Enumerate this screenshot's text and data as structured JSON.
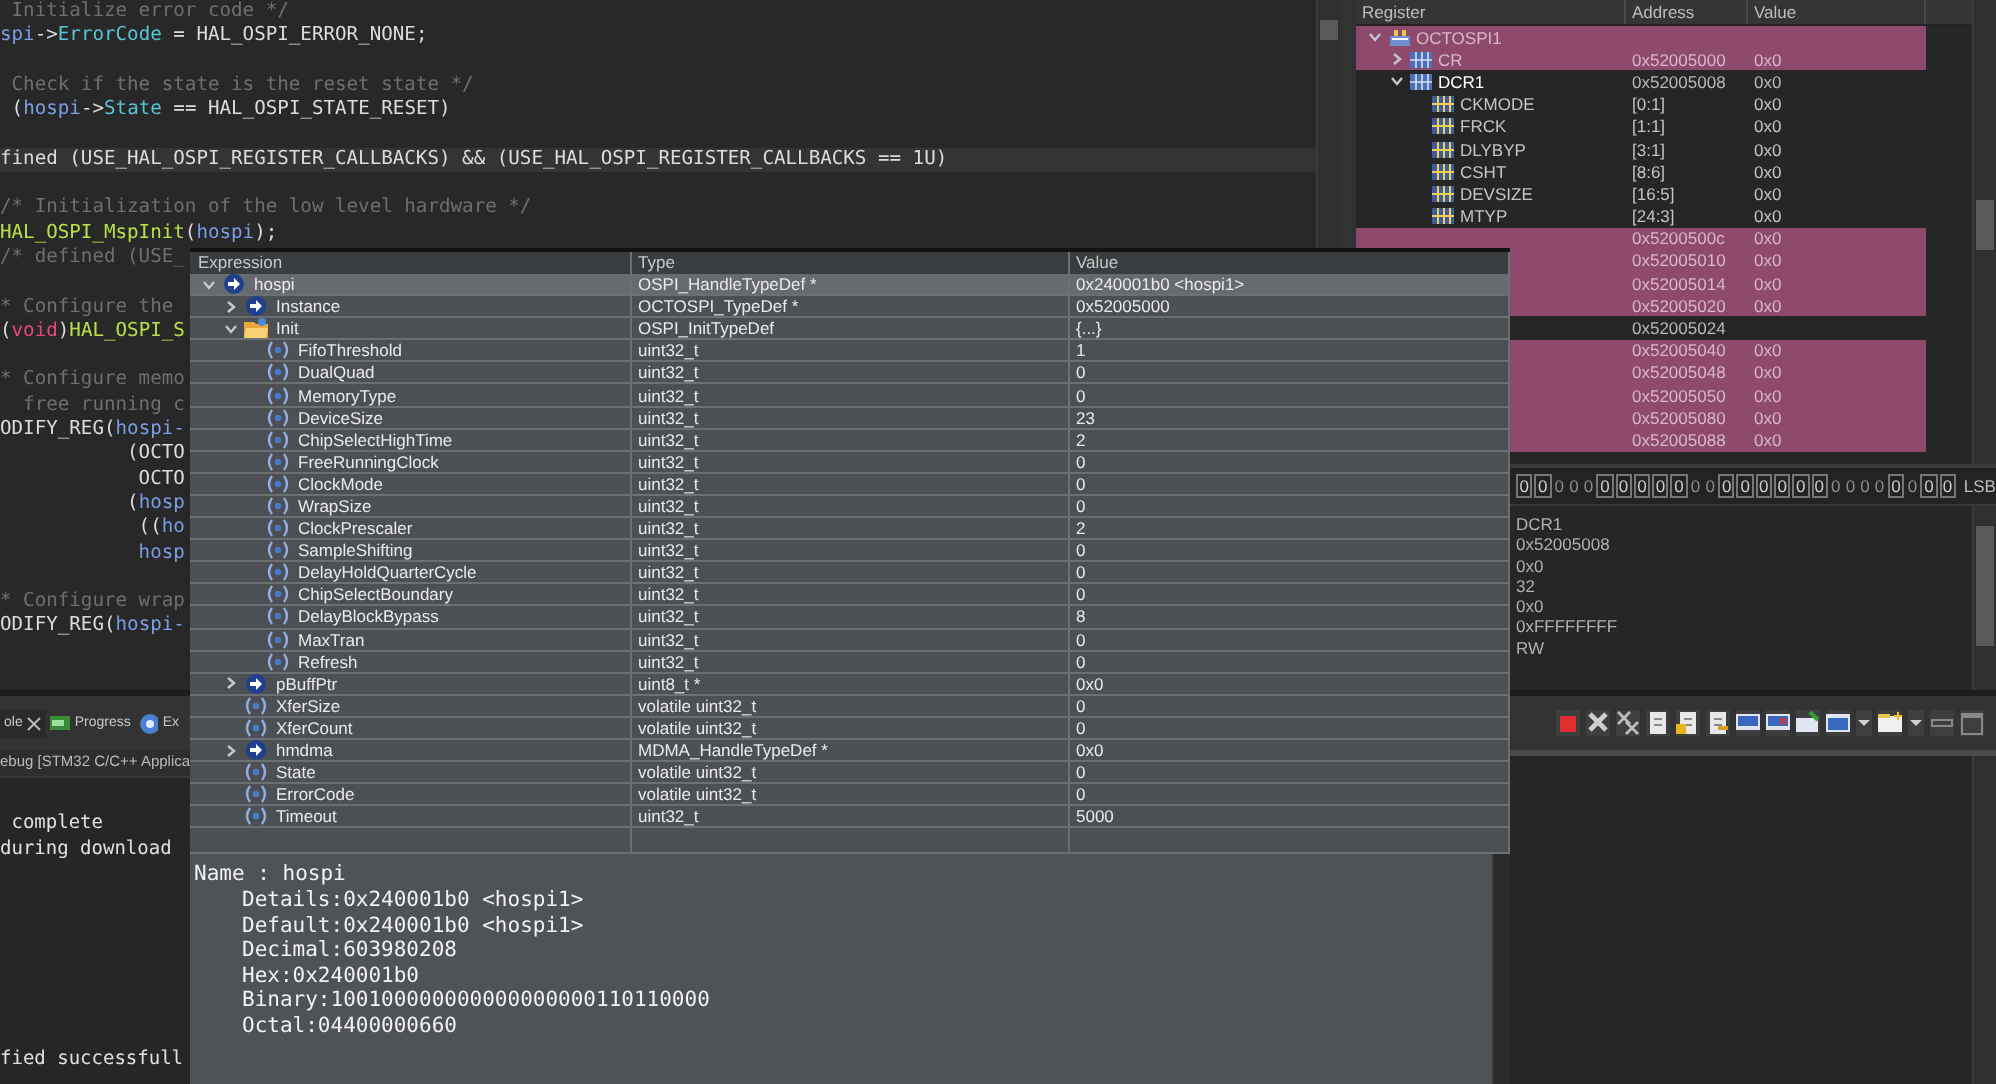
{
  "editor": {
    "lines": [
      {
        "kind": "code",
        "current": false,
        "segments": [
          {
            "text": " Initialize error code */",
            "kind": "comment"
          }
        ]
      },
      {
        "kind": "code",
        "current": false,
        "segments": [
          {
            "text": "spi",
            "kind": "var"
          },
          {
            "text": "->",
            "kind": "plain"
          },
          {
            "text": "ErrorCode",
            "kind": "field"
          },
          {
            "text": " = HAL_OSPI_ERROR_NONE;",
            "kind": "plain"
          }
        ]
      },
      {
        "kind": "blank"
      },
      {
        "kind": "code",
        "current": false,
        "segments": [
          {
            "text": " Check if the state is the reset state */",
            "kind": "comment"
          }
        ]
      },
      {
        "kind": "code",
        "current": false,
        "segments": [
          {
            "text": " (",
            "kind": "plain"
          },
          {
            "text": "hospi",
            "kind": "var"
          },
          {
            "text": "->",
            "kind": "plain"
          },
          {
            "text": "State",
            "kind": "field"
          },
          {
            "text": " == HAL_OSPI_STATE_RESET)",
            "kind": "plain"
          }
        ]
      },
      {
        "kind": "blank"
      },
      {
        "kind": "code",
        "current": true,
        "segments": [
          {
            "text": "fined (USE_HAL_OSPI_REGISTER_CALLBACKS) && (USE_HAL_OSPI_REGISTER_CALLBACKS == 1U)",
            "kind": "plain"
          }
        ]
      },
      {
        "kind": "blank"
      },
      {
        "kind": "code",
        "current": false,
        "segments": [
          {
            "text": "/* Initialization of the low level hardware */",
            "kind": "comment"
          }
        ]
      },
      {
        "kind": "code",
        "current": false,
        "segments": [
          {
            "text": "HAL_OSPI_MspInit",
            "kind": "func"
          },
          {
            "text": "(",
            "kind": "plain"
          },
          {
            "text": "hospi",
            "kind": "var"
          },
          {
            "text": ");",
            "kind": "plain"
          }
        ]
      },
      {
        "kind": "code",
        "current": false,
        "segments": [
          {
            "text": "/* defined (USE_",
            "kind": "comment"
          }
        ]
      },
      {
        "kind": "blank"
      },
      {
        "kind": "code",
        "current": false,
        "segments": [
          {
            "text": "* Configure the",
            "kind": "comment"
          }
        ]
      },
      {
        "kind": "code",
        "current": false,
        "segments": [
          {
            "text": "(",
            "kind": "plain"
          },
          {
            "text": "void",
            "kind": "keyword"
          },
          {
            "text": ")",
            "kind": "plain"
          },
          {
            "text": "HAL_OSPI_S",
            "kind": "func"
          }
        ]
      },
      {
        "kind": "blank"
      },
      {
        "kind": "code",
        "current": false,
        "segments": [
          {
            "text": "* Configure memo",
            "kind": "comment"
          }
        ]
      },
      {
        "kind": "code",
        "current": false,
        "segments": [
          {
            "text": "  free running c",
            "kind": "comment"
          }
        ]
      },
      {
        "kind": "code",
        "current": false,
        "segments": [
          {
            "text": "ODIFY_REG(",
            "kind": "plain"
          },
          {
            "text": "hospi-",
            "kind": "var"
          }
        ]
      },
      {
        "kind": "code",
        "current": false,
        "segments": [
          {
            "text": "           (OCTO",
            "kind": "plain"
          }
        ]
      },
      {
        "kind": "code",
        "current": false,
        "segments": [
          {
            "text": "            OCTO",
            "kind": "plain"
          }
        ]
      },
      {
        "kind": "code",
        "current": false,
        "segments": [
          {
            "text": "           (",
            "kind": "plain"
          },
          {
            "text": "hosp",
            "kind": "var"
          }
        ]
      },
      {
        "kind": "code",
        "current": false,
        "segments": [
          {
            "text": "            ((",
            "kind": "plain"
          },
          {
            "text": "ho",
            "kind": "var"
          }
        ]
      },
      {
        "kind": "code",
        "current": false,
        "segments": [
          {
            "text": "            hosp",
            "kind": "var"
          }
        ]
      },
      {
        "kind": "blank"
      },
      {
        "kind": "code",
        "current": false,
        "segments": [
          {
            "text": "* Configure wrap",
            "kind": "comment"
          }
        ]
      },
      {
        "kind": "code",
        "current": false,
        "segments": [
          {
            "text": "ODIFY_REG(",
            "kind": "plain"
          },
          {
            "text": "hospi-",
            "kind": "var"
          }
        ]
      }
    ]
  },
  "registers": {
    "columns": [
      "Register",
      "Address",
      "Value"
    ],
    "rows": [
      {
        "kind": "peripheral",
        "name": "OCTOSPI1",
        "changed": true,
        "expanded": true,
        "children": [
          {
            "kind": "register",
            "name": "CR",
            "address": "0x52005000",
            "value": "0x0",
            "changed": true,
            "expanded": false
          },
          {
            "kind": "register",
            "name": "DCR1",
            "address": "0x52005008",
            "value": "0x0",
            "changed": false,
            "expanded": true,
            "children": [
              {
                "kind": "field",
                "name": "CKMODE",
                "address": "[0:1]",
                "value": "0x0",
                "changed": false
              },
              {
                "kind": "field",
                "name": "FRCK",
                "address": "[1:1]",
                "value": "0x0",
                "changed": false
              },
              {
                "kind": "field",
                "name": "DLYBYP",
                "address": "[3:1]",
                "value": "0x0",
                "changed": false
              },
              {
                "kind": "field",
                "name": "CSHT",
                "address": "[8:6]",
                "value": "0x0",
                "changed": false
              },
              {
                "kind": "field",
                "name": "DEVSIZE",
                "address": "[16:5]",
                "value": "0x0",
                "changed": false
              },
              {
                "kind": "field",
                "name": "MTYP",
                "address": "[24:3]",
                "value": "0x0",
                "changed": false
              }
            ]
          },
          {
            "kind": "register",
            "address": "0x5200500c",
            "value": "0x0",
            "changed": true
          },
          {
            "kind": "register",
            "address": "0x52005010",
            "value": "0x0",
            "changed": true
          },
          {
            "kind": "register",
            "address": "0x52005014",
            "value": "0x0",
            "changed": true
          },
          {
            "kind": "register",
            "address": "0x52005020",
            "value": "0x0",
            "changed": true
          },
          {
            "kind": "register",
            "address": "0x52005024",
            "changed": false
          },
          {
            "kind": "register",
            "address": "0x52005040",
            "value": "0x0",
            "changed": true
          },
          {
            "kind": "register",
            "address": "0x52005048",
            "value": "0x0",
            "changed": true
          },
          {
            "kind": "register",
            "address": "0x52005050",
            "value": "0x0",
            "changed": true
          },
          {
            "kind": "register",
            "address": "0x52005080",
            "value": "0x0",
            "changed": true
          },
          {
            "kind": "register",
            "address": "0x52005088",
            "value": "0x0",
            "changed": true
          }
        ]
      }
    ]
  },
  "bit_field": {
    "bits": [
      {
        "text": "0",
        "boxed": true
      },
      {
        "text": "0",
        "boxed": true
      },
      {
        "text": "0",
        "boxed": false
      },
      {
        "text": "0",
        "boxed": false
      },
      {
        "text": "0",
        "boxed": false
      },
      {
        "text": "0",
        "boxed": true
      },
      {
        "text": "0",
        "boxed": true
      },
      {
        "text": "0",
        "boxed": true
      },
      {
        "text": "0",
        "boxed": true
      },
      {
        "text": "0",
        "boxed": true
      },
      {
        "text": "0",
        "boxed": false
      },
      {
        "text": "0",
        "boxed": false
      },
      {
        "text": "0",
        "boxed": true
      },
      {
        "text": "0",
        "boxed": true
      },
      {
        "text": "0",
        "boxed": true
      },
      {
        "text": "0",
        "boxed": true
      },
      {
        "text": "0",
        "boxed": true
      },
      {
        "text": "0",
        "boxed": true
      },
      {
        "text": "0",
        "boxed": false
      },
      {
        "text": "0",
        "boxed": false
      },
      {
        "text": "0",
        "boxed": false
      },
      {
        "text": "0",
        "boxed": false
      },
      {
        "text": "0",
        "boxed": true
      },
      {
        "text": "0",
        "boxed": false
      },
      {
        "text": "0",
        "boxed": true
      },
      {
        "text": "0",
        "boxed": true
      }
    ],
    "label": "LSB"
  },
  "register_details": [
    "DCR1",
    "0x52005008",
    "0x0",
    "32",
    "0x0",
    "0xFFFFFFFF",
    "RW"
  ],
  "bottom_tabs": [
    {
      "label": "ole",
      "kind": "console",
      "selected": true
    },
    {
      "label": "Progress",
      "kind": "progress",
      "selected": false
    },
    {
      "label": "Ex",
      "kind": "expressions",
      "selected": false
    }
  ],
  "console": {
    "launch": "ebug [STM32 C/C++ Applica",
    "lines": [
      " complete",
      "during download"
    ],
    "last_line": "fied successfull"
  },
  "expressions": {
    "columns": [
      "Expression",
      "Type",
      "Value"
    ],
    "rows": [
      {
        "kind": "pointer",
        "name": "hospi",
        "type": "OSPI_HandleTypeDef *",
        "value": "0x240001b0 <hospi1>",
        "selected": true,
        "expanded": true,
        "children": [
          {
            "kind": "pointer",
            "name": "Instance",
            "type": "OCTOSPI_TypeDef *",
            "value": "0x52005000",
            "selected": false,
            "expanded": false
          },
          {
            "kind": "struct",
            "name": "Init",
            "type": "OSPI_InitTypeDef",
            "value": "{...}",
            "selected": false,
            "expanded": true,
            "children": [
              {
                "kind": "field",
                "name": "FifoThreshold",
                "type": "uint32_t",
                "value": "1",
                "selected": false
              },
              {
                "kind": "field",
                "name": "DualQuad",
                "type": "uint32_t",
                "value": "0",
                "selected": false
              },
              {
                "kind": "field",
                "name": "MemoryType",
                "type": "uint32_t",
                "value": "0",
                "selected": false
              },
              {
                "kind": "field",
                "name": "DeviceSize",
                "type": "uint32_t",
                "value": "23",
                "selected": false
              },
              {
                "kind": "field",
                "name": "ChipSelectHighTime",
                "type": "uint32_t",
                "value": "2",
                "selected": false
              },
              {
                "kind": "field",
                "name": "FreeRunningClock",
                "type": "uint32_t",
                "value": "0",
                "selected": false
              },
              {
                "kind": "field",
                "name": "ClockMode",
                "type": "uint32_t",
                "value": "0",
                "selected": false
              },
              {
                "kind": "field",
                "name": "WrapSize",
                "type": "uint32_t",
                "value": "0",
                "selected": false
              },
              {
                "kind": "field",
                "name": "ClockPrescaler",
                "type": "uint32_t",
                "value": "2",
                "selected": false
              },
              {
                "kind": "field",
                "name": "SampleShifting",
                "type": "uint32_t",
                "value": "0",
                "selected": false
              },
              {
                "kind": "field",
                "name": "DelayHoldQuarterCycle",
                "type": "uint32_t",
                "value": "0",
                "selected": false
              },
              {
                "kind": "field",
                "name": "ChipSelectBoundary",
                "type": "uint32_t",
                "value": "0",
                "selected": false
              },
              {
                "kind": "field",
                "name": "DelayBlockBypass",
                "type": "uint32_t",
                "value": "8",
                "selected": false
              },
              {
                "kind": "field",
                "name": "MaxTran",
                "type": "uint32_t",
                "value": "0",
                "selected": false
              },
              {
                "kind": "field",
                "name": "Refresh",
                "type": "uint32_t",
                "value": "0",
                "selected": false
              }
            ]
          },
          {
            "kind": "pointer",
            "name": "pBuffPtr",
            "type": "uint8_t *",
            "value": "0x0",
            "selected": false,
            "expanded": false
          },
          {
            "kind": "field",
            "name": "XferSize",
            "type": "volatile uint32_t",
            "value": "0",
            "selected": false
          },
          {
            "kind": "field",
            "name": "XferCount",
            "type": "volatile uint32_t",
            "value": "0",
            "selected": false
          },
          {
            "kind": "pointer",
            "name": "hmdma",
            "type": "MDMA_HandleTypeDef *",
            "value": "0x0",
            "selected": false,
            "expanded": false
          },
          {
            "kind": "field",
            "name": "State",
            "type": "volatile uint32_t",
            "value": "0",
            "selected": false
          },
          {
            "kind": "field",
            "name": "ErrorCode",
            "type": "volatile uint32_t",
            "value": "0",
            "selected": false
          },
          {
            "kind": "field",
            "name": "Timeout",
            "type": "uint32_t",
            "value": "5000",
            "selected": false
          }
        ]
      }
    ],
    "details": {
      "title": "Name : hospi",
      "lines": [
        "Details:0x240001b0 <hospi1>",
        "Default:0x240001b0 <hospi1>",
        "Decimal:603980208",
        "Hex:0x240001b0",
        "Binary:100100000000000000000110110000",
        "Octal:04400000660"
      ]
    }
  }
}
